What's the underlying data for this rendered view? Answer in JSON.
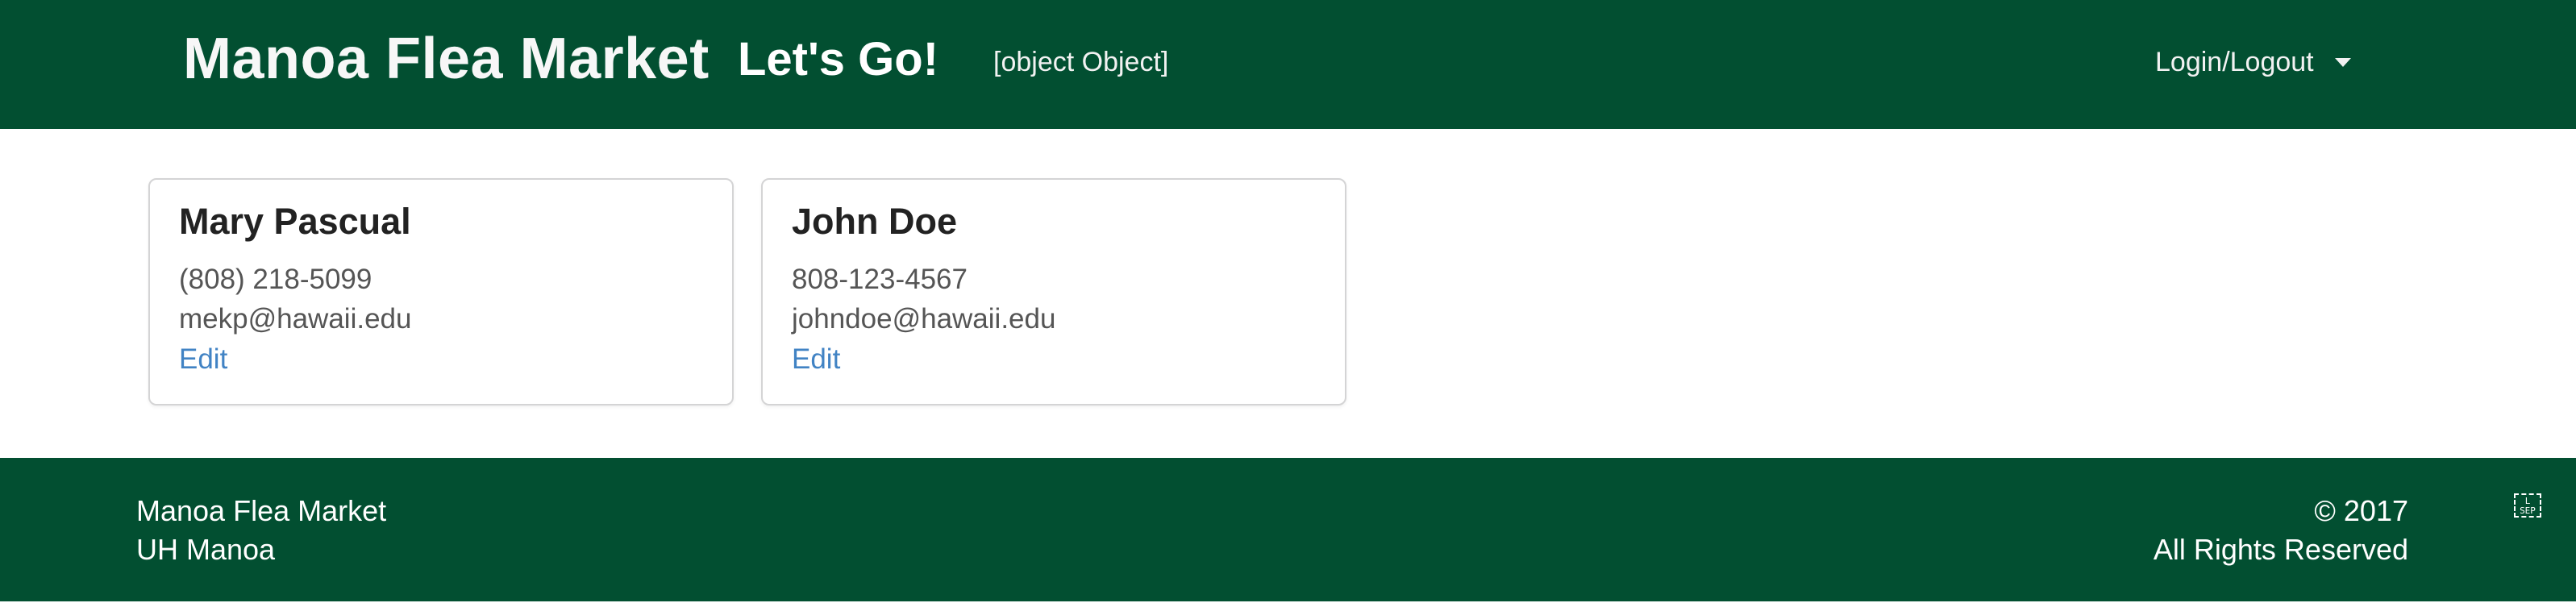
{
  "navbar": {
    "brand": "Manoa Flea Market",
    "lets_go": "Let's Go!",
    "object_text": "[object Object]",
    "login": "Login/Logout"
  },
  "contacts": [
    {
      "name": "Mary Pascual",
      "phone": "(808) 218-5099",
      "email": "mekp@hawaii.edu",
      "edit": "Edit"
    },
    {
      "name": "John Doe",
      "phone": "808-123-4567",
      "email": "johndoe@hawaii.edu",
      "edit": "Edit"
    }
  ],
  "footer": {
    "line1": "Manoa Flea Market",
    "line2": "UH Manoa",
    "copyright": "©  2017",
    "rights": "All Rights Reserved",
    "icon_text_top": "L",
    "icon_text_bottom": "SEP"
  },
  "colors": {
    "brand_green": "#024f31",
    "link_blue": "#4183c4"
  }
}
